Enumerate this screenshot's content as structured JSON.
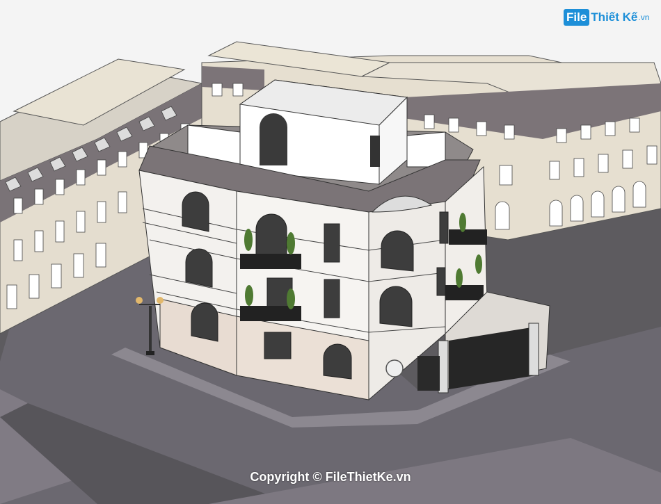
{
  "watermark": {
    "logo_box": "File",
    "logo_text": "Thiết Kế",
    "logo_domain": ".vn",
    "copyright": "Copyright © FileThietKe.vn"
  },
  "colors": {
    "road": "#5c5a5e",
    "pavement": "#74707a",
    "facade": "#f3f1ee",
    "roof": "#8f8a8a",
    "background_building": "#e6dfd0",
    "mansard": "#7b7477",
    "accent_logo": "#1d8fd8"
  }
}
